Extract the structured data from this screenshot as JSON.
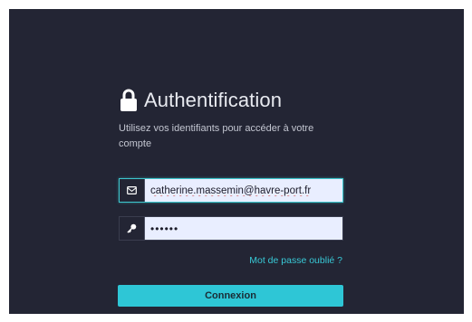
{
  "login": {
    "title": "Authentification",
    "subtitle": "Utilisez vos identifiants pour accéder à votre compte",
    "email_icon": "envelope-icon",
    "email_value": "catherine.massemin@havre-port.fr",
    "password_icon": "key-icon",
    "password_value": "••••••",
    "forgot_link": "Mot de passe oublié ?",
    "submit_label": "Connexion"
  },
  "colors": {
    "background": "#232534",
    "accent": "#2ec6d6",
    "input_bg": "#e9eeff"
  }
}
